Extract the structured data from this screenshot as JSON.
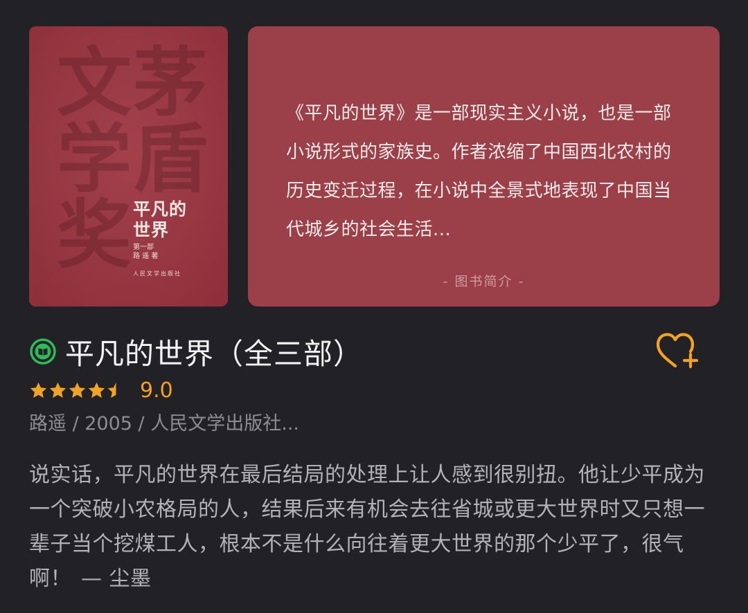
{
  "cover": {
    "background_characters": [
      "文",
      "茅",
      "学",
      "盾",
      "奖"
    ],
    "title_line1": "平凡的",
    "title_line2": "世界",
    "volume": "第一部",
    "author": "路 遥 著",
    "publisher": "人民文学出版社"
  },
  "intro": {
    "text": "《平凡的世界》是一部现实主义小说，也是一部小说形式的家族史。作者浓缩了中国西北农村的历史变迁过程，在小说中全景式地表现了中国当代城乡的社会生活...",
    "footer_label": "- 图书简介 -"
  },
  "book": {
    "title": "平凡的世界（全三部）",
    "rating_stars": 4.5,
    "rating_score": "9.0",
    "meta": "路遥 / 2005 / 人民文学出版社..."
  },
  "review": {
    "text": "说实话，平凡的世界在最后结局的处理上让人感到很别扭。他让少平成为一个突破小农格局的人，结果后来有机会去往省城或更大世界时又只想一辈子当个挖煤工人，根本不是什么向往着更大世界的那个少平了，很气啊！",
    "author": "— 尘墨"
  },
  "icons": {
    "read_status": "green-book-icon",
    "favorite": "heart-plus-icon",
    "star": "star-icon"
  },
  "colors": {
    "background": "#222226",
    "cover": "#9c3a44",
    "intro_card": "#9b3f48",
    "accent_green": "#2bbd5a",
    "accent_orange": "#f1a326"
  }
}
